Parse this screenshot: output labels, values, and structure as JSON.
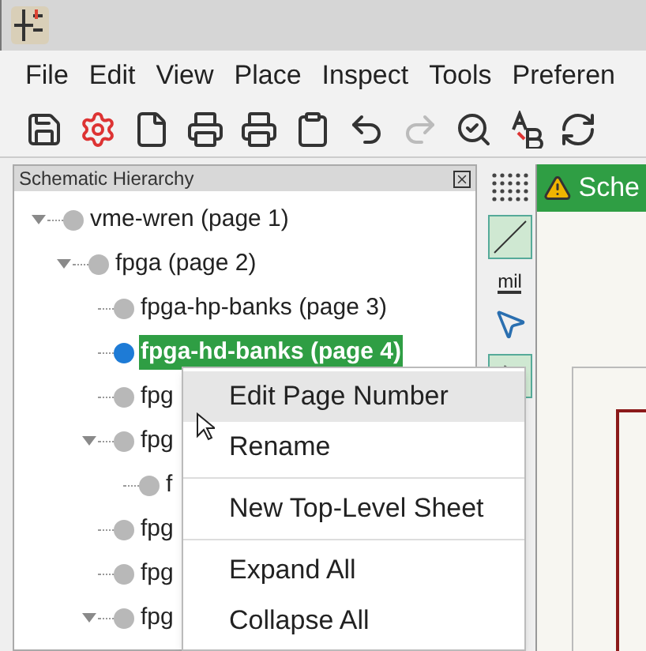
{
  "menu_bar": [
    "File",
    "Edit",
    "View",
    "Place",
    "Inspect",
    "Tools",
    "Preferen"
  ],
  "hierarchy": {
    "title": "Schematic Hierarchy",
    "items": [
      {
        "label": "vme-wren (page 1)",
        "selected": false,
        "expanded": true,
        "children": [
          {
            "label": "fpga (page 2)",
            "selected": false,
            "expanded": true,
            "children": [
              {
                "label": "fpga-hp-banks (page 3)",
                "selected": false
              },
              {
                "label": "fpga-hd-banks (page 4)",
                "selected": true
              },
              {
                "label": "fpg",
                "selected": false
              },
              {
                "label": "fpg",
                "selected": false,
                "expanded": true,
                "children": [
                  {
                    "label": "f",
                    "selected": false
                  }
                ]
              },
              {
                "label": "fpg",
                "selected": false
              },
              {
                "label": "fpg",
                "selected": false
              },
              {
                "label": "fpg",
                "selected": false,
                "expanded": true
              }
            ]
          }
        ]
      }
    ]
  },
  "side_toolbar": {
    "units": "mil"
  },
  "document_tab": {
    "label": "Sche"
  },
  "context_menu": [
    [
      {
        "label": "Edit Page Number",
        "selected": true
      },
      {
        "label": "Rename",
        "selected": false
      }
    ],
    [
      {
        "label": "New Top-Level Sheet",
        "selected": false
      }
    ],
    [
      {
        "label": "Expand All",
        "selected": false
      },
      {
        "label": "Collapse All",
        "selected": false
      }
    ]
  ]
}
